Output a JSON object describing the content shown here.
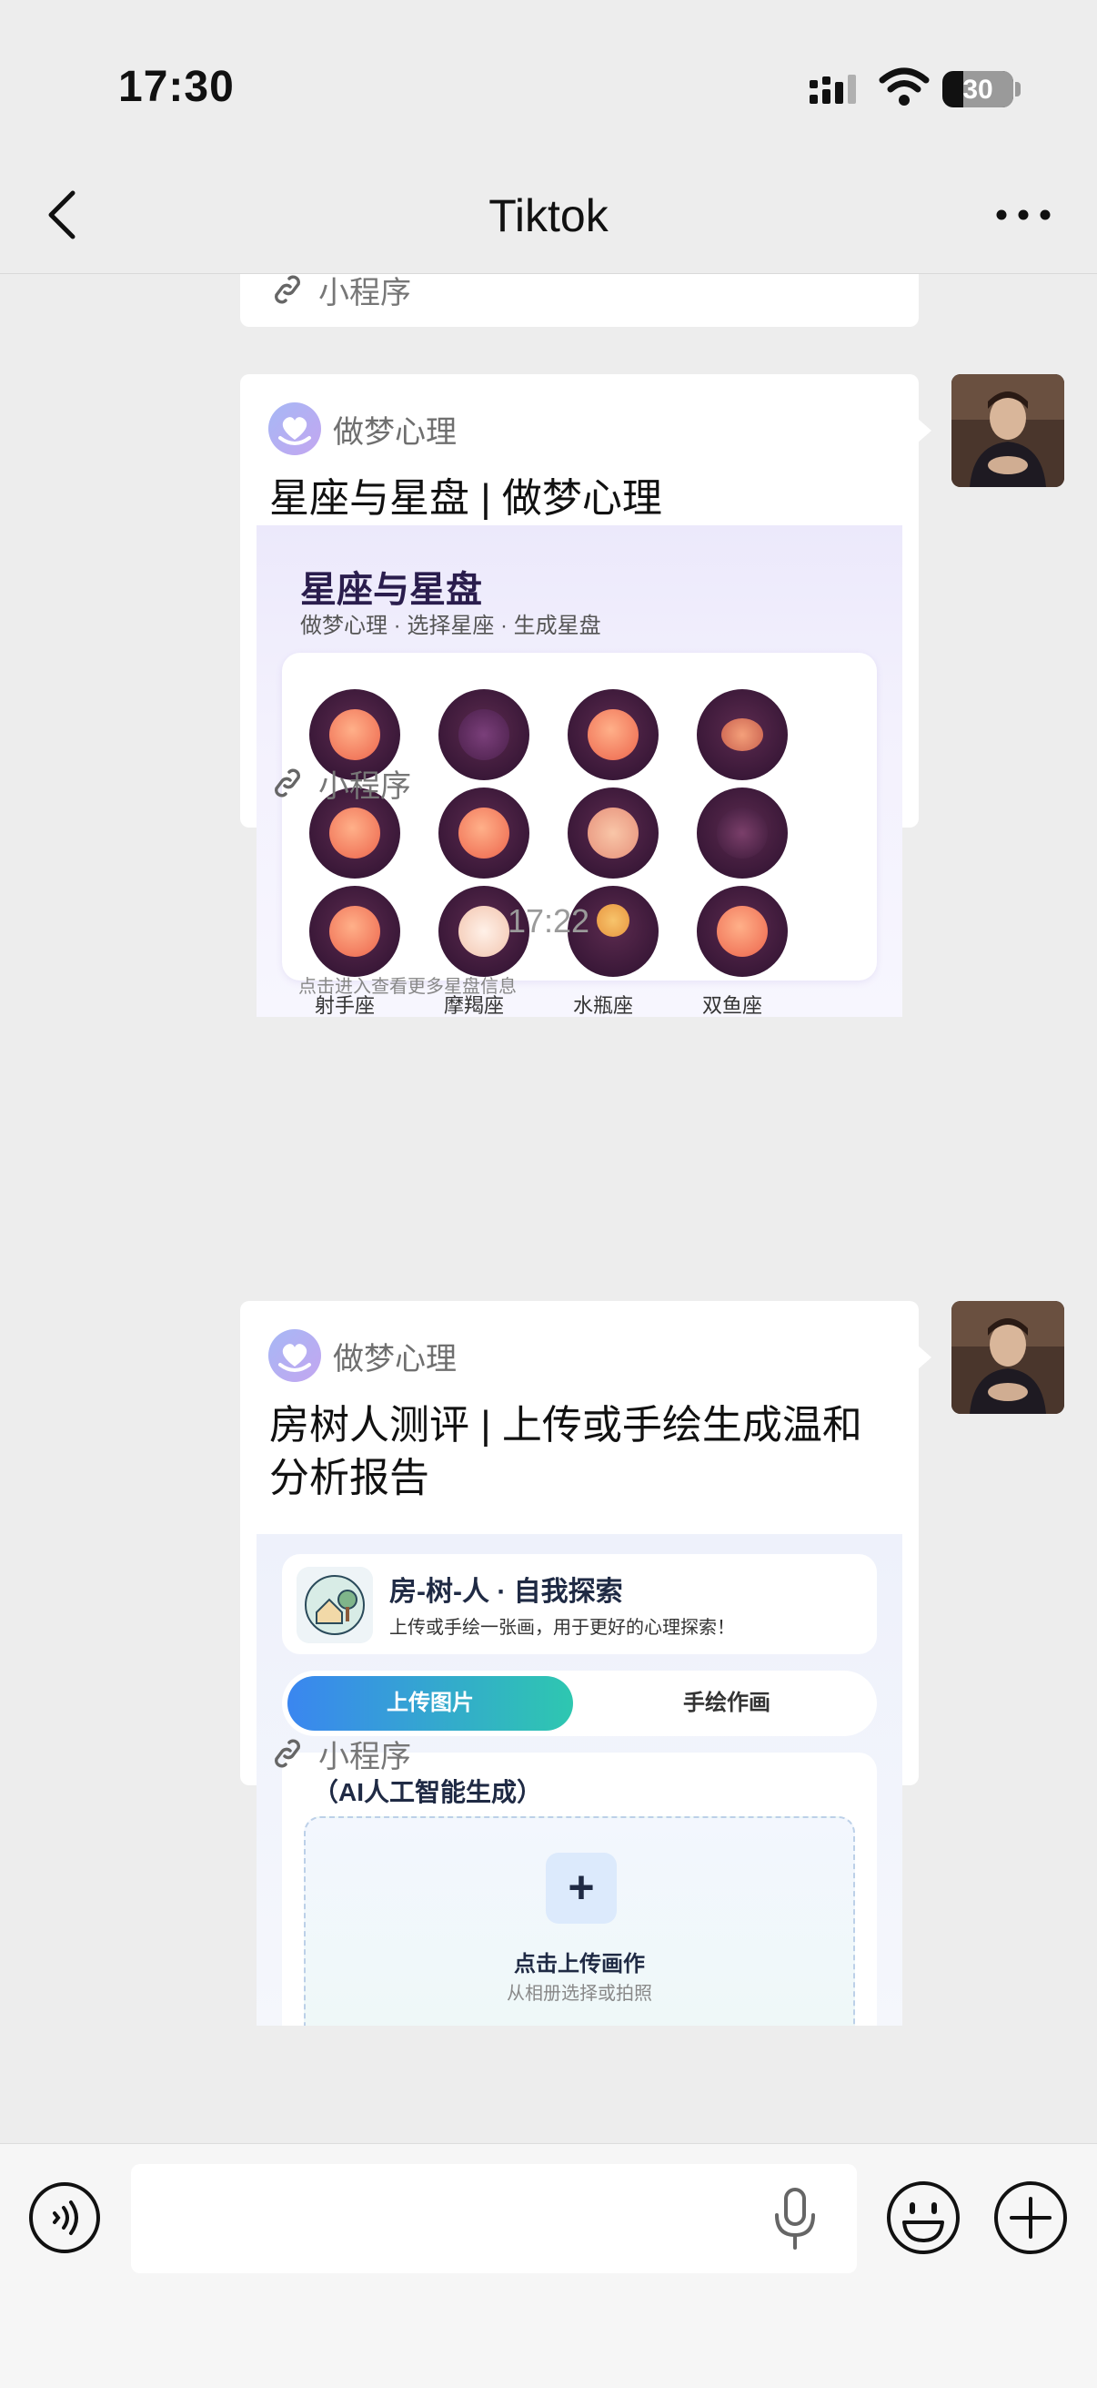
{
  "status_bar": {
    "time": "17:30",
    "battery_text": "30",
    "battery_level": 0.3
  },
  "nav": {
    "title": "Tiktok",
    "back_icon": "chevron-left-icon",
    "more_icon": "more-horizontal-icon"
  },
  "messages": {
    "partial_card": {
      "footer_label": "小程序"
    },
    "card1": {
      "mp_name": "做梦心理",
      "title": "星座与星盘 | 做梦心理",
      "preview": {
        "title": "星座与星盘",
        "subtitle": "做梦心理 · 选择星座 · 生成星盘",
        "hint": "点击进入查看更多星盘信息",
        "labels": [
          "射手座",
          "摩羯座",
          "水瓶座",
          "双鱼座"
        ]
      },
      "footer_label": "小程序"
    },
    "timestamp": "17:22",
    "card2": {
      "mp_name": "做梦心理",
      "title": "房树人测评 | 上传或手绘生成温和分析报告",
      "preview": {
        "header_title": "房-树-人 · 自我探索",
        "header_subtitle": "上传或手绘一张画，用于更好的心理探索！",
        "tab_active": "上传图片",
        "tab_other": "手绘作画",
        "panel_title": "（AI人工智能生成）",
        "upload_title": "点击上传画作",
        "upload_subtitle": "从相册选择或拍照"
      },
      "footer_label": "小程序"
    }
  },
  "input_bar": {
    "placeholder": "",
    "voice_icon": "voice-mode-icon",
    "mic_icon": "microphone-icon",
    "emoji_icon": "emoji-icon",
    "plus_icon": "plus-circle-icon"
  },
  "colors": {
    "background": "#ededed",
    "card": "#ffffff",
    "accent_gradient_start": "#3a86f0",
    "accent_gradient_end": "#2ec7b0"
  }
}
